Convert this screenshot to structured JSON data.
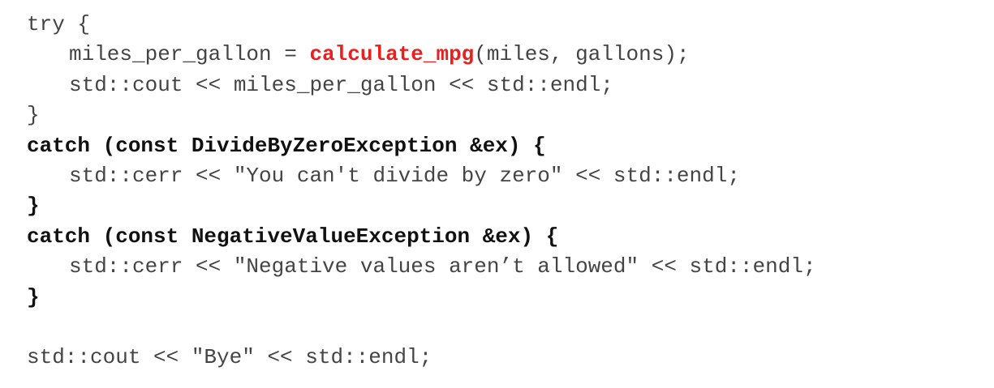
{
  "code": {
    "line1": "try {",
    "line2_pre": "miles_per_gallon = ",
    "line2_func": "calculate_mpg",
    "line2_post": "(miles, gallons);",
    "line3": "std::cout << miles_per_gallon << std::endl;",
    "line4": "}",
    "line5": "catch (const DivideByZeroException &ex) {",
    "line6": "std::cerr << \"You can't divide by zero\" << std::endl;",
    "line7": "}",
    "line8": "catch (const NegativeValueException &ex) {",
    "line9": "std::cerr << \"Negative values aren’t allowed\" << std::endl;",
    "line10": "}",
    "line12": "std::cout << \"Bye\" << std::endl;"
  },
  "colors": {
    "text": "#444444",
    "bold_text": "#111111",
    "highlight": "#e8201f",
    "background": "#ffffff"
  }
}
